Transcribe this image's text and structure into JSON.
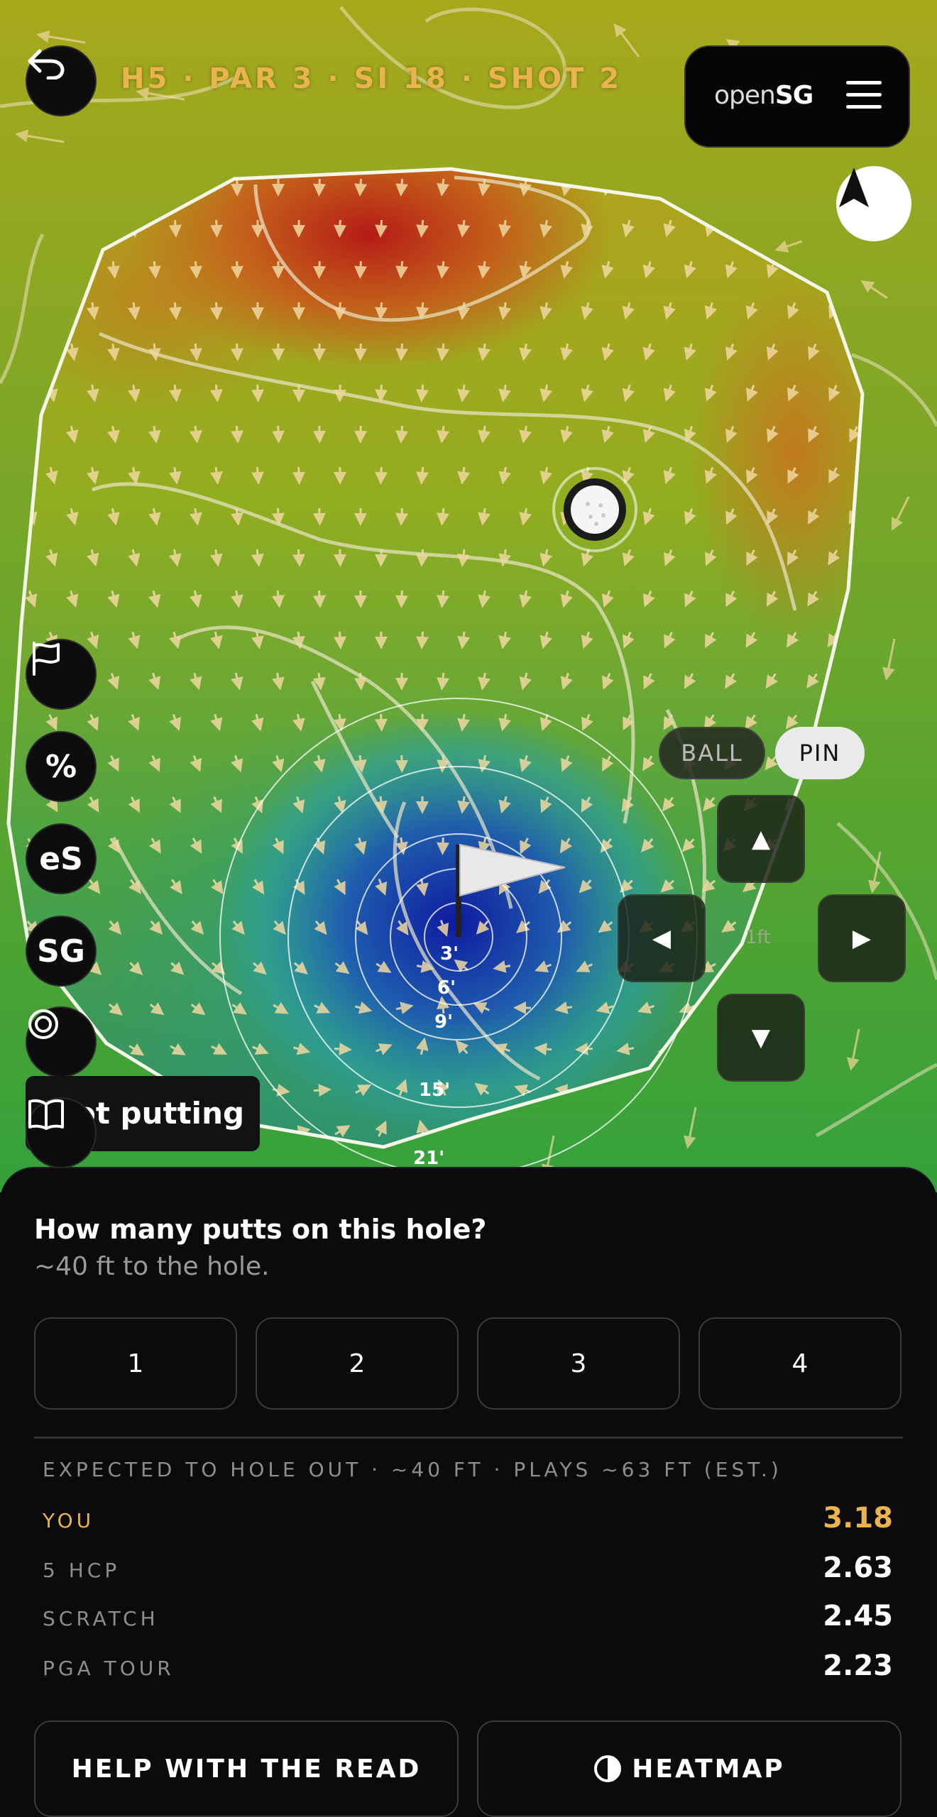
{
  "header": {
    "title": "H5 · PAR 3 · SI 18 · SHOT 2",
    "brand_light": "open",
    "brand_bold": "SG"
  },
  "map": {
    "distance_rings": [
      "3'",
      "6'",
      "9'",
      "15'",
      "21'"
    ],
    "side_tools": [
      "flag-icon",
      "%",
      "eS",
      "SG",
      "target-icon",
      "book-icon"
    ],
    "toast": "ot putting",
    "mode_toggle": {
      "ball": "BALL",
      "pin": "PIN",
      "selected": "PIN"
    },
    "nudge_step": "1ft",
    "icons": [
      "back-icon",
      "menu-icon",
      "compass-icon",
      "ball-icon",
      "pin-flag-icon"
    ]
  },
  "sheet": {
    "question": "How many putts on this hole?",
    "subtitle": "~40 ft to the hole.",
    "putt_options": [
      "1",
      "2",
      "3",
      "4"
    ],
    "expected_heading": "EXPECTED TO HOLE OUT · ~40 FT · PLAYS ~63 FT (EST.)",
    "rows": [
      {
        "label": "YOU",
        "value": "3.18"
      },
      {
        "label": "5 HCP",
        "value": "2.63"
      },
      {
        "label": "SCRATCH",
        "value": "2.45"
      },
      {
        "label": "PGA TOUR",
        "value": "2.23"
      }
    ],
    "help_button": "HELP WITH THE READ",
    "heatmap_button": "HEATMAP"
  },
  "colors": {
    "accent": "#e9b44c",
    "background": "#0b0b0d",
    "heat_high": "#b0201a",
    "heat_mid": "#9fb21e",
    "heat_low": "#1a2fa8"
  }
}
